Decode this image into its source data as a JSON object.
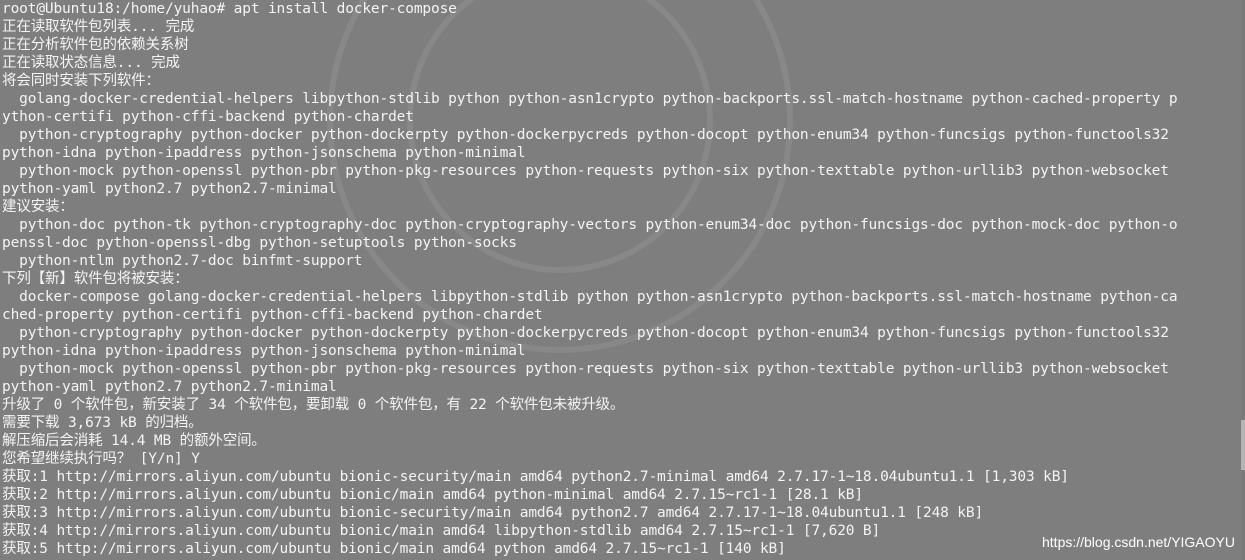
{
  "terminal": {
    "lines": [
      "root@Ubuntu18:/home/yuhao# apt install docker-compose",
      "正在读取软件包列表... 完成",
      "正在分析软件包的依赖关系树",
      "正在读取状态信息... 完成",
      "将会同时安装下列软件：",
      "  golang-docker-credential-helpers libpython-stdlib python python-asn1crypto python-backports.ssl-match-hostname python-cached-property p",
      "ython-certifi python-cffi-backend python-chardet",
      "  python-cryptography python-docker python-dockerpty python-dockerpycreds python-docopt python-enum34 python-funcsigs python-functools32",
      "python-idna python-ipaddress python-jsonschema python-minimal",
      "  python-mock python-openssl python-pbr python-pkg-resources python-requests python-six python-texttable python-urllib3 python-websocket",
      "python-yaml python2.7 python2.7-minimal",
      "建议安装：",
      "  python-doc python-tk python-cryptography-doc python-cryptography-vectors python-enum34-doc python-funcsigs-doc python-mock-doc python-o",
      "penssl-doc python-openssl-dbg python-setuptools python-socks",
      "  python-ntlm python2.7-doc binfmt-support",
      "下列【新】软件包将被安装：",
      "  docker-compose golang-docker-credential-helpers libpython-stdlib python python-asn1crypto python-backports.ssl-match-hostname python-ca",
      "ched-property python-certifi python-cffi-backend python-chardet",
      "  python-cryptography python-docker python-dockerpty python-dockerpycreds python-docopt python-enum34 python-funcsigs python-functools32",
      "python-idna python-ipaddress python-jsonschema python-minimal",
      "  python-mock python-openssl python-pbr python-pkg-resources python-requests python-six python-texttable python-urllib3 python-websocket",
      "python-yaml python2.7 python2.7-minimal",
      "升级了 0 个软件包，新安装了 34 个软件包，要卸载 0 个软件包，有 22 个软件包未被升级。",
      "需要下载 3,673 kB 的归档。",
      "解压缩后会消耗 14.4 MB 的额外空间。",
      "您希望继续执行吗？ [Y/n] Y",
      "获取:1 http://mirrors.aliyun.com/ubuntu bionic-security/main amd64 python2.7-minimal amd64 2.7.17-1~18.04ubuntu1.1 [1,303 kB]",
      "获取:2 http://mirrors.aliyun.com/ubuntu bionic/main amd64 python-minimal amd64 2.7.15~rc1-1 [28.1 kB]",
      "获取:3 http://mirrors.aliyun.com/ubuntu bionic-security/main amd64 python2.7 amd64 2.7.17-1~18.04ubuntu1.1 [248 kB]",
      "获取:4 http://mirrors.aliyun.com/ubuntu bionic/main amd64 libpython-stdlib amd64 2.7.15~rc1-1 [7,620 B]",
      "获取:5 http://mirrors.aliyun.com/ubuntu bionic/main amd64 python amd64 2.7.15~rc1-1 [140 kB]"
    ]
  },
  "watermark": "https://blog.csdn.net/YIGAOYU"
}
